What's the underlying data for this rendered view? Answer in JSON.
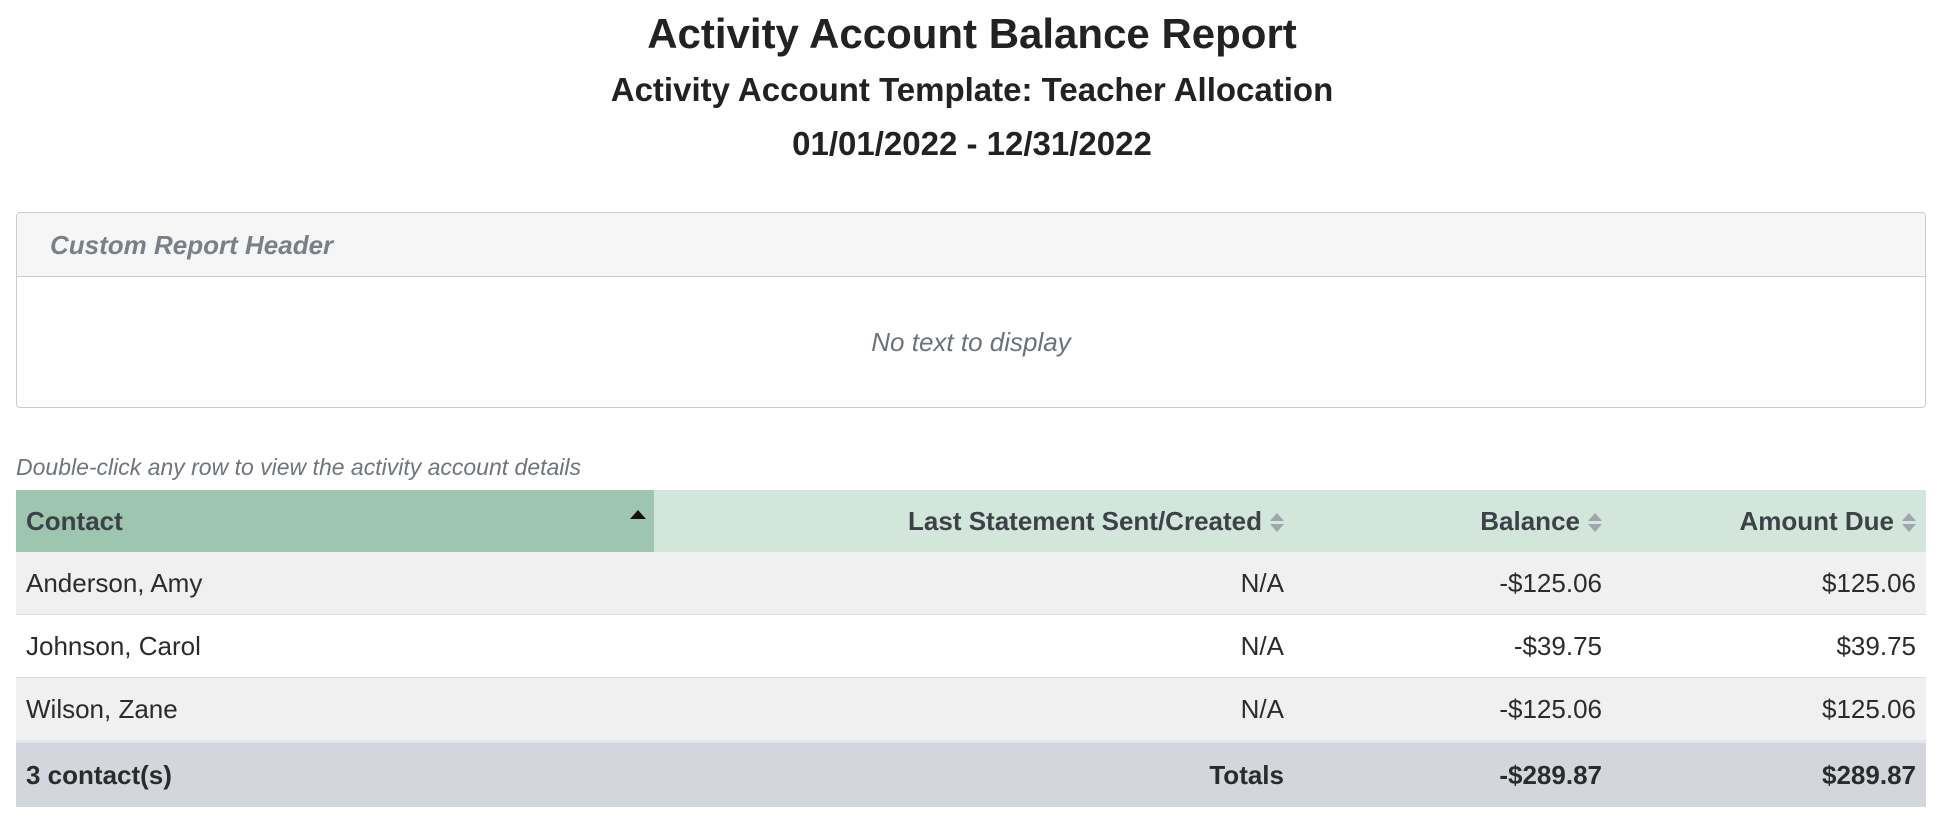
{
  "report": {
    "title": "Activity Account Balance Report",
    "subtitle": "Activity Account Template: Teacher Allocation",
    "date_range": "01/01/2022 - 12/31/2022"
  },
  "custom_header": {
    "title": "Custom Report Header",
    "body": "No text to display"
  },
  "hint": "Double-click any row to view the activity account details",
  "table": {
    "columns": [
      {
        "label": "Contact",
        "sort": "ascending"
      },
      {
        "label": "Last Statement Sent/Created",
        "sort": "none"
      },
      {
        "label": "Balance",
        "sort": "none"
      },
      {
        "label": "Amount Due",
        "sort": "none"
      }
    ],
    "rows": [
      {
        "contact": "Anderson, Amy",
        "last_statement": "N/A",
        "balance": "-$125.06",
        "amount_due": "$125.06"
      },
      {
        "contact": "Johnson, Carol",
        "last_statement": "N/A",
        "balance": "-$39.75",
        "amount_due": "$39.75"
      },
      {
        "contact": "Wilson, Zane",
        "last_statement": "N/A",
        "balance": "-$125.06",
        "amount_due": "$125.06"
      }
    ],
    "totals": {
      "count_label": "3 contact(s)",
      "label": "Totals",
      "balance": "-$289.87",
      "amount_due": "$289.87"
    }
  },
  "colors": {
    "header_bg": "#d3e6dc",
    "sorted_header_bg": "#9dc5b0",
    "totals_bg": "#d3d6dc",
    "row_alt_bg": "#f0f0f0"
  }
}
